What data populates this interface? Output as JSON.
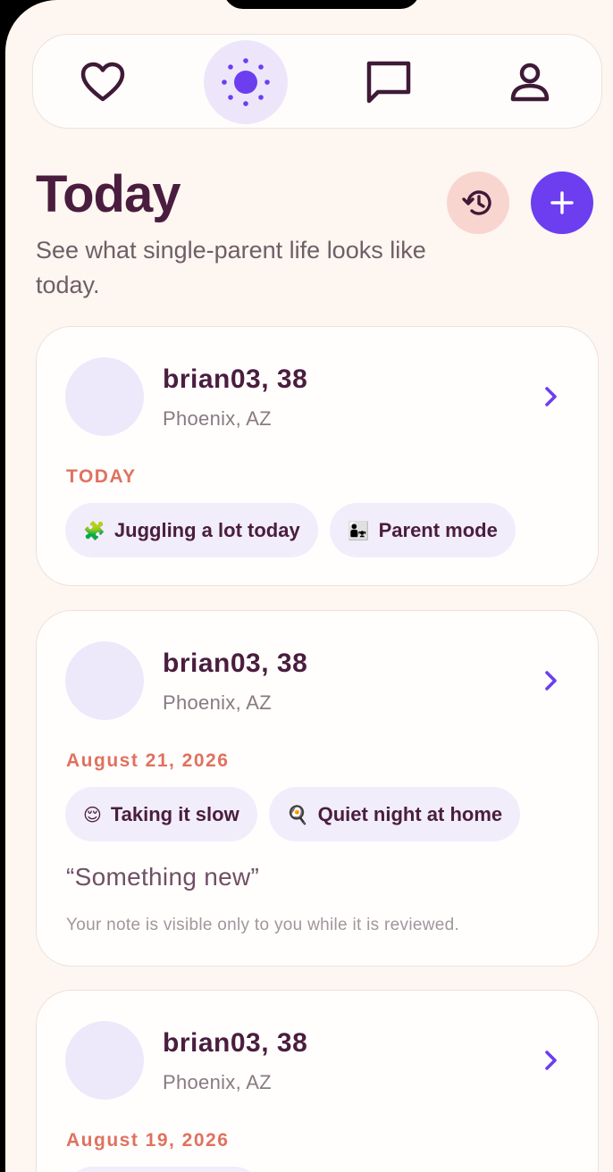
{
  "nav": {
    "items": [
      {
        "icon": "heart-icon"
      },
      {
        "icon": "sun-icon",
        "active": true
      },
      {
        "icon": "chat-icon"
      },
      {
        "icon": "profile-icon"
      }
    ]
  },
  "header": {
    "title": "Today",
    "subtitle": "See what single-parent life looks like today."
  },
  "actions": {
    "history_icon": "history-icon",
    "add_icon": "plus-icon"
  },
  "colors": {
    "accent": "#6c3ef0",
    "title": "#4a1d3e",
    "date": "#e0715f",
    "background": "#fdf6f1"
  },
  "cards": [
    {
      "name": "brian03, 38",
      "location": "Phoenix, AZ",
      "date": "TODAY",
      "chips": [
        {
          "emoji": "🧩",
          "label": "Juggling a lot today"
        },
        {
          "emoji": "👨‍👧",
          "label": "Parent mode"
        }
      ]
    },
    {
      "name": "brian03, 38",
      "location": "Phoenix, AZ",
      "date": "August 21, 2026",
      "chips": [
        {
          "emoji": "😌",
          "label": "Taking it slow"
        },
        {
          "emoji": "🍳",
          "label": "Quiet night at home"
        }
      ],
      "note": "“Something new”",
      "note_sub": "Your note is visible only to you while it is reviewed."
    },
    {
      "name": "brian03, 38",
      "location": "Phoenix, AZ",
      "date": "August 19, 2026"
    }
  ]
}
